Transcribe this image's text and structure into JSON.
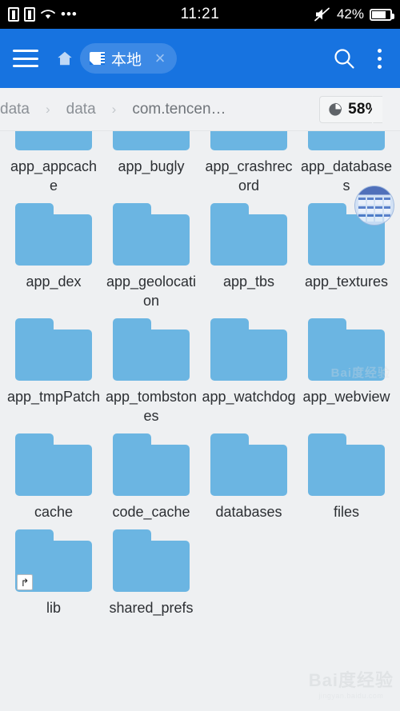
{
  "status_bar": {
    "time": "11:21",
    "battery_percent": "42%",
    "icons": [
      "sim-card-icon",
      "sim-card-icon",
      "wifi-icon",
      "more-dots-icon",
      "mute-icon",
      "battery-icon"
    ]
  },
  "toolbar": {
    "menu_icon": "hamburger-menu-icon",
    "home_icon": "home-icon",
    "tab": {
      "icon": "sd-card-icon",
      "label": "本地",
      "close_label": "×"
    },
    "search_icon": "search-icon",
    "overflow_icon": "kebab-menu-icon"
  },
  "breadcrumb": {
    "separator": "›",
    "items": [
      "data",
      "data",
      "com.tencen…"
    ],
    "storage_badge": {
      "icon": "pie-chart-icon",
      "value": "58%"
    }
  },
  "file_grid": {
    "rows": [
      [
        {
          "name": "app_appcache",
          "clipped": true
        },
        {
          "name": "app_bugly",
          "clipped": true
        },
        {
          "name": "app_crashrecord",
          "clipped": true
        },
        {
          "name": "app_databases",
          "clipped": true
        }
      ],
      [
        {
          "name": "app_dex"
        },
        {
          "name": "app_geolocation"
        },
        {
          "name": "app_tbs"
        },
        {
          "name": "app_textures",
          "badge": "app-grid-circle-watermark"
        }
      ],
      [
        {
          "name": "app_tmpPatch"
        },
        {
          "name": "app_tombstones"
        },
        {
          "name": "app_watchdog"
        },
        {
          "name": "app_webview"
        }
      ],
      [
        {
          "name": "cache"
        },
        {
          "name": "code_cache"
        },
        {
          "name": "databases"
        },
        {
          "name": "files"
        }
      ],
      [
        {
          "name": "lib",
          "badge": "shortcut-link-icon"
        },
        {
          "name": "shared_prefs"
        }
      ]
    ]
  },
  "watermarks": {
    "brand": "Bai度经验",
    "sub": "jingyan.baidu.com",
    "secondary": "Bai度经验"
  },
  "colors": {
    "accent": "#1773e0",
    "folder": "#6bb5e2",
    "page_bg": "#eef0f2",
    "status_bar_bg": "#000000"
  }
}
